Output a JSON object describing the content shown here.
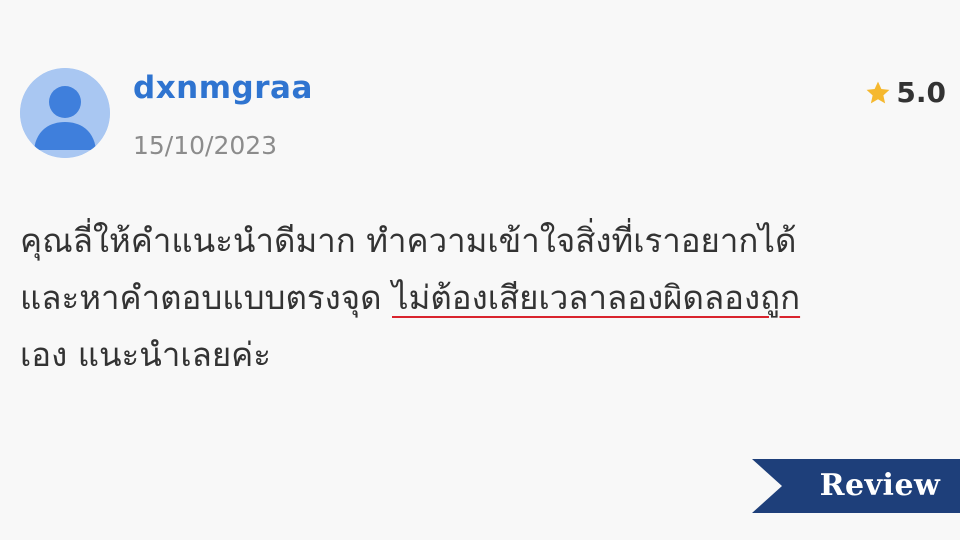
{
  "review": {
    "username": "dxnmgraa",
    "date": "15/10/2023",
    "rating": "5.0",
    "rating_icon": "star-icon",
    "text_lines": {
      "line1": "คุณลี่ให้คำแนะนำดีมาก ทำความเข้าใจสิ่งที่เราอยากได้",
      "line2_prefix": "และหาคำตอบแบบตรงจุด ",
      "line2_highlight": "ไม่ต้องเสียเวลาลองผิดลองถูก",
      "line3": "เอง แนะนำเลยค่ะ"
    }
  },
  "banner": {
    "label": "Review"
  },
  "colors": {
    "background": "#f8f8f8",
    "username": "#2f74d0",
    "date": "#8c8c8c",
    "star": "#f5b82e",
    "text": "#333333",
    "underline": "#d9232d",
    "banner": "#1e3f7a",
    "avatar_bg": "#a9c7f2",
    "avatar_fg": "#3f7fdc"
  }
}
